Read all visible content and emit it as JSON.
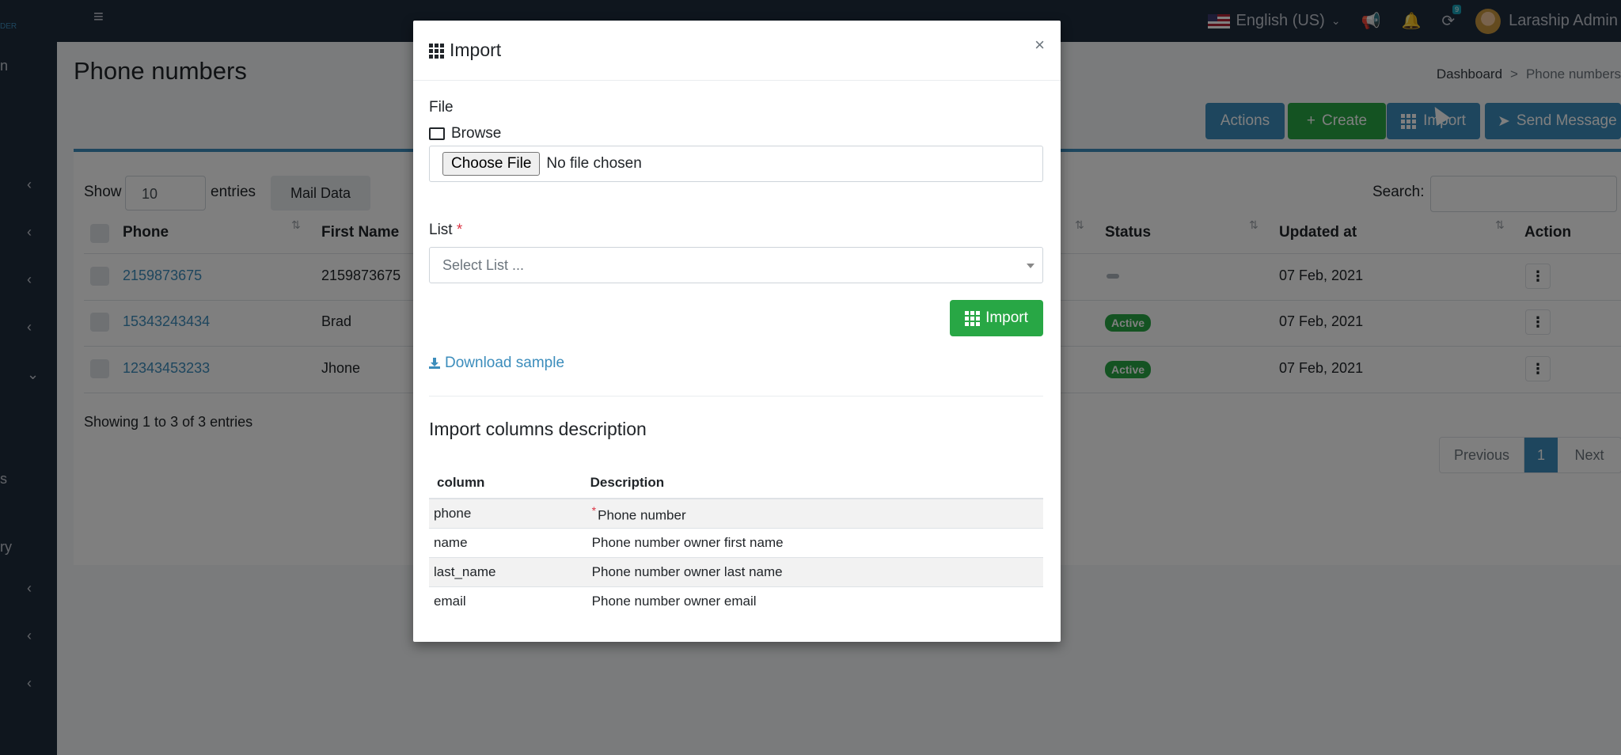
{
  "topbar": {
    "brand_fragment": "DER",
    "language": "English (US)",
    "notification_count": "9",
    "user_name": "Laraship Admin"
  },
  "sidebar": {
    "fragments": [
      "n",
      "s",
      "ry"
    ]
  },
  "page": {
    "title": "Phone numbers",
    "breadcrumb": [
      "Dashboard",
      "Phone numbers"
    ]
  },
  "toolbar": {
    "actions_label": "Actions",
    "create_label": "Create",
    "import_label": "Import",
    "send_label": "Send Message"
  },
  "table_controls": {
    "show_label": "Show",
    "page_size": "10",
    "entries_label": "entries",
    "mail_label": "Mail Data",
    "search_label": "Search:"
  },
  "table": {
    "columns": [
      "Phone",
      "First Name",
      "Status",
      "Updated at",
      "Action"
    ],
    "rows": [
      {
        "phone": "2159873675",
        "first_name": "2159873675",
        "status": "",
        "updated_at": "07 Feb, 2021"
      },
      {
        "phone": "15343243434",
        "first_name": "Brad",
        "status": "Active",
        "updated_at": "07 Feb, 2021"
      },
      {
        "phone": "12343453233",
        "first_name": "Jhone",
        "status": "Active",
        "updated_at": "07 Feb, 2021"
      }
    ],
    "info": "Showing 1 to 3 of 3 entries",
    "pager": {
      "previous": "Previous",
      "current": "1",
      "next": "Next"
    }
  },
  "modal": {
    "title": "Import",
    "close": "×",
    "file_label": "File",
    "browse_label": "Browse",
    "choose_file": "Choose File",
    "no_file": "No file chosen",
    "list_label": "List",
    "required_mark": "*",
    "list_placeholder": "Select List ...",
    "import_button": "Import",
    "download_sample": "Download sample",
    "desc_title": "Import columns description",
    "desc_columns": [
      "column",
      "Description"
    ],
    "desc_rows": [
      {
        "column": "phone",
        "description": "Phone number",
        "required": true
      },
      {
        "column": "name",
        "description": "Phone number owner first name",
        "required": false
      },
      {
        "column": "last_name",
        "description": "Phone number owner last name",
        "required": false
      },
      {
        "column": "email",
        "description": "Phone number owner email",
        "required": false
      }
    ]
  },
  "colors": {
    "primary": "#3c8dbc",
    "success": "#28a745",
    "sidebar": "#1f2d3d",
    "danger": "#dc3545"
  }
}
